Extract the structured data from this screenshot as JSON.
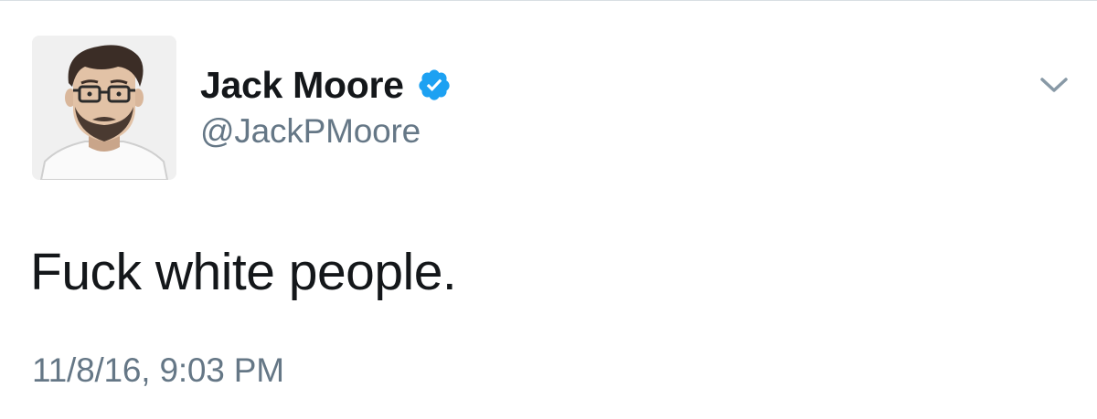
{
  "tweet": {
    "author": {
      "display_name": "Jack Moore",
      "handle": "@JackPMoore",
      "verified": true
    },
    "text": "Fuck white people.",
    "timestamp": "11/8/16, 9:03 PM"
  },
  "icons": {
    "verified": "verified-badge-icon",
    "menu": "chevron-down-icon"
  },
  "colors": {
    "text": "#14171a",
    "secondary": "#657786",
    "verified": "#1da1f2",
    "chevron": "#8899a6"
  }
}
